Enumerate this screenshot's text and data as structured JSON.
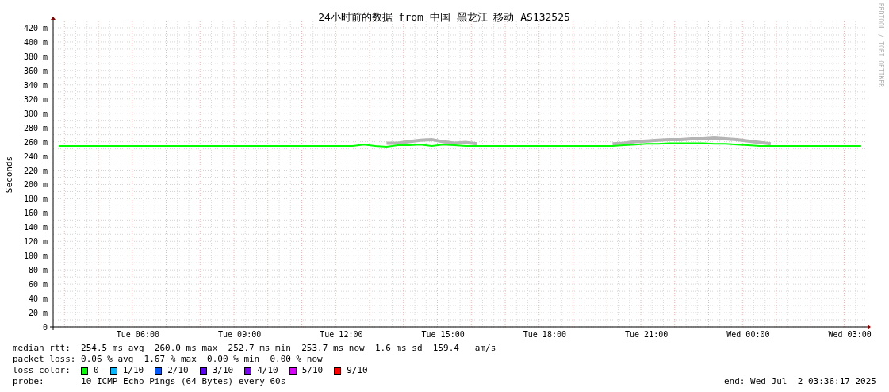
{
  "graph": {
    "title": "24小时前的数据 from 中国 黑龙江 移动 AS132525",
    "watermark_side": "RRDTOOL / TOBI OETIKER",
    "chart_data": {
      "type": "line",
      "ylabel": "Seconds",
      "ylim": [
        0,
        420
      ],
      "categories": [
        null,
        null,
        null,
        null,
        null,
        null,
        null,
        "Tue 06:00",
        null,
        null,
        null,
        null,
        null,
        null,
        null,
        null,
        "Tue 09:00",
        null,
        null,
        null,
        null,
        null,
        null,
        null,
        null,
        "Tue 12:00",
        null,
        null,
        null,
        null,
        null,
        null,
        null,
        null,
        "Tue 15:00",
        null,
        null,
        null,
        null,
        null,
        null,
        null,
        null,
        "Tue 18:00",
        null,
        null,
        null,
        null,
        null,
        null,
        null,
        null,
        "Tue 21:00",
        null,
        null,
        null,
        null,
        null,
        null,
        null,
        null,
        "Wed 00:00",
        null,
        null,
        null,
        null,
        null,
        null,
        null,
        null,
        "Wed 03:00",
        null
      ],
      "grid": true,
      "series": [
        {
          "color": "#b4b4b4",
          "values": [
            null,
            null,
            null,
            null,
            null,
            null,
            null,
            null,
            null,
            null,
            null,
            null,
            null,
            null,
            null,
            null,
            null,
            null,
            null,
            null,
            null,
            null,
            null,
            null,
            null,
            null,
            null,
            null,
            null,
            258,
            258,
            260,
            262,
            263,
            260,
            258,
            259,
            257,
            null,
            null,
            null,
            null,
            null,
            null,
            null,
            null,
            null,
            null,
            null,
            257,
            258,
            260,
            261,
            262,
            263,
            263,
            264,
            264,
            265,
            264,
            263,
            261,
            259,
            257,
            null,
            null,
            null,
            null,
            null,
            null,
            null,
            null
          ]
        },
        {
          "color": "#00ff00",
          "values": [
            254,
            254,
            254,
            254,
            254,
            254,
            254,
            254,
            254,
            254,
            254,
            254,
            254,
            254,
            254,
            254,
            254,
            254,
            254,
            254,
            254,
            254,
            254,
            254,
            254,
            254,
            254,
            256,
            254,
            253,
            255,
            255,
            256,
            254,
            256,
            255,
            254,
            254,
            254,
            254,
            254,
            254,
            254,
            254,
            254,
            254,
            254,
            254,
            254,
            254,
            255,
            256,
            257,
            257,
            258,
            258,
            258,
            258,
            257,
            257,
            256,
            255,
            254,
            254,
            254,
            254,
            254,
            254,
            254,
            254,
            254,
            254
          ]
        }
      ],
      "yticks": [
        {
          "value": 0,
          "label": "0"
        },
        {
          "value": 20,
          "label": "20 m"
        },
        {
          "value": 40,
          "label": "40 m"
        },
        {
          "value": 60,
          "label": "60 m"
        },
        {
          "value": 80,
          "label": "80 m"
        },
        {
          "value": 100,
          "label": "100 m"
        },
        {
          "value": 120,
          "label": "120 m"
        },
        {
          "value": 140,
          "label": "140 m"
        },
        {
          "value": 160,
          "label": "160 m"
        },
        {
          "value": 180,
          "label": "180 m"
        },
        {
          "value": 200,
          "label": "200 m"
        },
        {
          "value": 220,
          "label": "220 m"
        },
        {
          "value": 240,
          "label": "240 m"
        },
        {
          "value": 260,
          "label": "260 m"
        },
        {
          "value": 280,
          "label": "280 m"
        },
        {
          "value": 300,
          "label": "300 m"
        },
        {
          "value": 320,
          "label": "320 m"
        },
        {
          "value": 340,
          "label": "340 m"
        },
        {
          "value": 360,
          "label": "360 m"
        },
        {
          "value": 380,
          "label": "380 m"
        },
        {
          "value": 400,
          "label": "400 m"
        },
        {
          "value": 420,
          "label": "420 m"
        }
      ]
    }
  },
  "legend": {
    "stats": [
      {
        "label": "median rtt:",
        "text": "254.5 ms avg  260.0 ms max  252.7 ms min  253.7 ms now  1.6 ms sd  159.4   am/s"
      },
      {
        "label": "packet loss:",
        "text": "0.06 % avg  1.67 % max  0.00 % min  0.00 % now"
      }
    ],
    "loss_colors": {
      "label": "loss color:",
      "items": [
        {
          "label": "0",
          "color": "#00ff00"
        },
        {
          "label": "1/10",
          "color": "#00b8ff"
        },
        {
          "label": "2/10",
          "color": "#0059ff"
        },
        {
          "label": "3/10",
          "color": "#5e00ff"
        },
        {
          "label": "4/10",
          "color": "#7e00ff"
        },
        {
          "label": "5/10",
          "color": "#dd00ff"
        },
        {
          "label": "9/10",
          "color": "#ff0000"
        }
      ]
    },
    "probe": {
      "label": "probe:",
      "text": "10 ICMP Echo Pings (64 Bytes) every 60s"
    },
    "end": "end: Wed Jul  2 03:36:17 2025"
  }
}
